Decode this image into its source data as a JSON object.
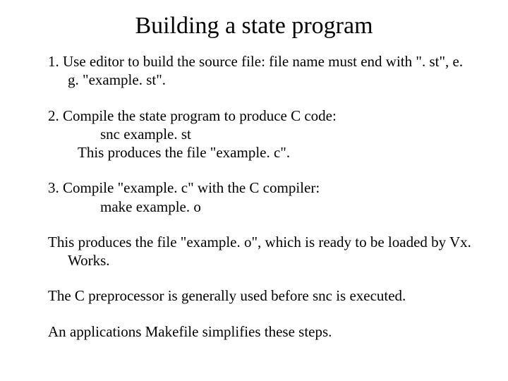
{
  "title": "Building a state program",
  "step1": "1.  Use editor to build the source file:  file name must end with  \". st\", e. g. \"example. st\".",
  "step2_a": "2.  Compile the state program to produce C code:",
  "step2_b": "snc  example. st",
  "step2_c": "This produces the file  \"example. c\".",
  "step3_a": "3.  Compile \"example. c\" with the C compiler:",
  "step3_b": "make example. o",
  "para1": "This produces the file \"example. o\", which is ready to be loaded by Vx. Works.",
  "para2": "The C preprocessor is generally used before snc is executed.",
  "para3": "An applications Makefile simplifies these steps."
}
